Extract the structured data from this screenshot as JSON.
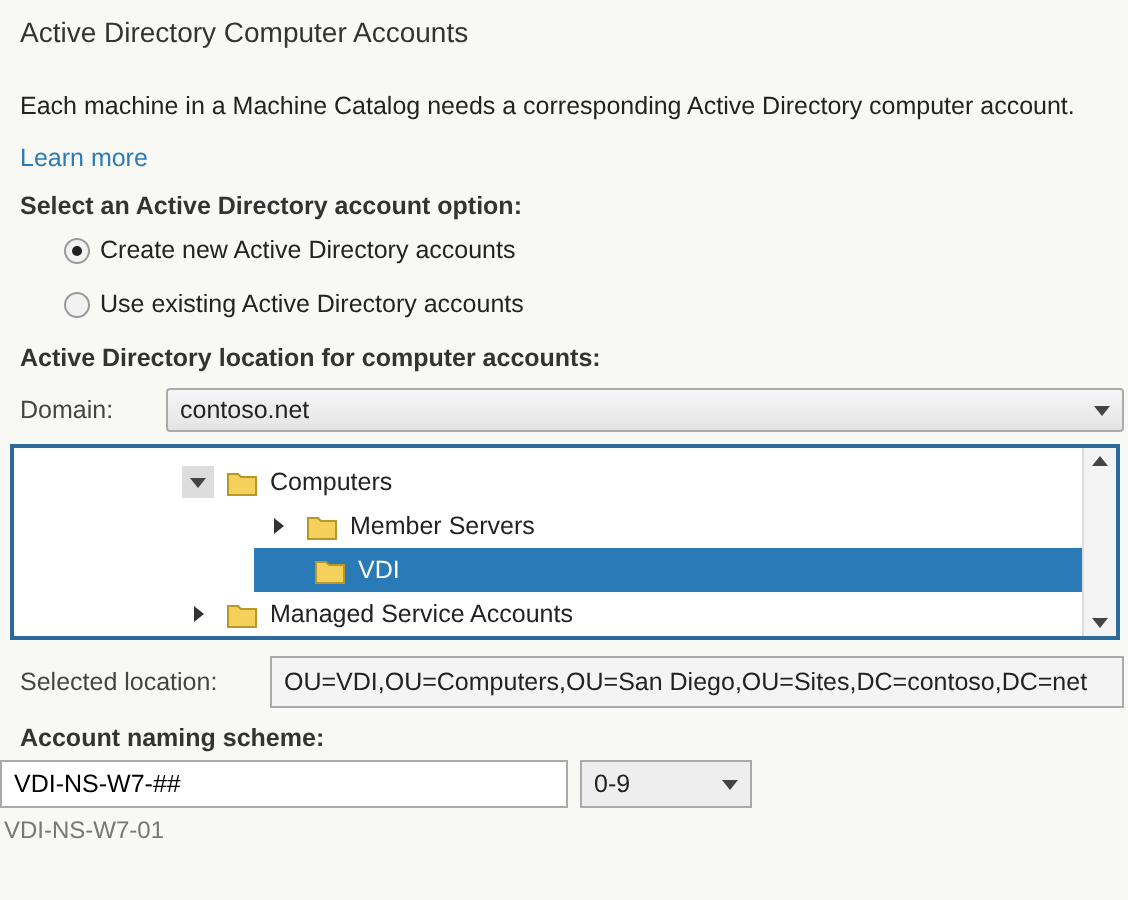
{
  "title": "Active Directory Computer Accounts",
  "description": "Each machine in a Machine Catalog needs a corresponding Active Directory computer account.",
  "learn_more": "Learn more",
  "option_label": "Select an Active Directory account option:",
  "options": [
    {
      "label": "Create new Active Directory accounts",
      "selected": true
    },
    {
      "label": "Use existing Active Directory accounts",
      "selected": false
    }
  ],
  "location_label": "Active Directory location for computer accounts:",
  "domain": {
    "label": "Domain:",
    "value": "contoso.net"
  },
  "tree": [
    {
      "label": "Computers",
      "expanded": true,
      "selected": false,
      "children": [
        {
          "label": "Member Servers",
          "expanded": false,
          "selected": false
        },
        {
          "label": "VDI",
          "selected": true
        }
      ]
    },
    {
      "label": "Managed Service Accounts",
      "expanded": false,
      "selected": false
    }
  ],
  "selected_location": {
    "label": "Selected location:",
    "value": "OU=VDI,OU=Computers,OU=San Diego,OU=Sites,DC=contoso,DC=net"
  },
  "naming": {
    "label": "Account naming scheme:",
    "value": "VDI-NS-W7-##",
    "suffix_type": "0-9",
    "preview": "VDI-NS-W7-01"
  }
}
